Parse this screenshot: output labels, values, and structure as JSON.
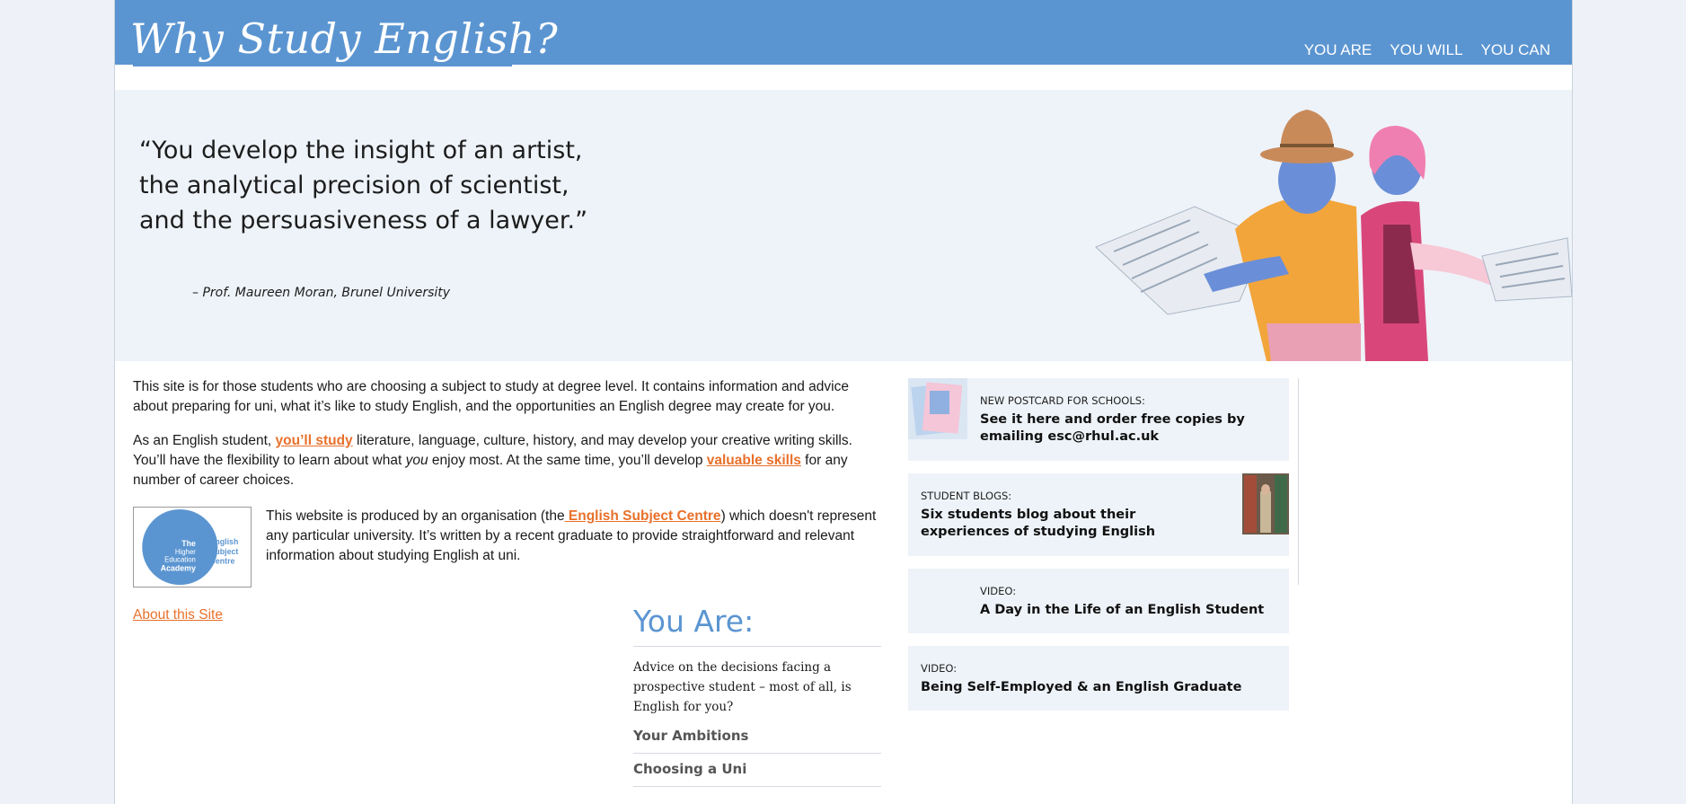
{
  "header": {
    "logo_text": "Why Study English?",
    "nav": [
      "YOU ARE",
      "YOU WILL",
      "YOU CAN"
    ]
  },
  "hero": {
    "quote": "“You develop the insight of an artist, the analytical precision of scientist, and the persuasiveness of a lawyer.”",
    "attribution": "– Prof. Maureen Moran, Brunel University"
  },
  "intro": {
    "p1": "This site is for those students who are choosing a subject to study at degree level. It contains information and advice about preparing for uni, what it’s like to study English, and the opportunities an English degree may create for you.",
    "p2_a": "As an English student, ",
    "p2_link1": "you’ll study",
    "p2_b": " literature, language, culture, history, and may develop your creative writing skills. You’ll have the flexibility to learn about what ",
    "p2_em": "you",
    "p2_c": " enjoy most. At the same time, you’ll develop ",
    "p2_link2": "valuable skills",
    "p2_d": " for any number of career choices."
  },
  "org": {
    "logo_line1": "The Higher Education Academy",
    "logo_line2": "English Subject Centre",
    "text_a": "This website is produced by an organisation (the",
    "link": " English Subject Centre",
    "text_b": ") which doesn't represent any particular university. It’s written by a recent graduate to provide straightforward and relevant information about studying English at uni."
  },
  "about_link": "About this Site",
  "you_are": {
    "title": "You Are:",
    "description": "Advice on the decisions facing a prospective student – most of all, is English for you?",
    "links": [
      "Your Ambitions",
      "Choosing a Uni"
    ]
  },
  "sidebar": {
    "cards": [
      {
        "kicker": "NEW POSTCARD FOR SCHOOLS:",
        "title": "See it here and order free copies by emailing esc@rhul.ac.uk"
      },
      {
        "kicker": "STUDENT BLOGS:",
        "title": "Six students blog about their experiences of studying English"
      },
      {
        "kicker": "VIDEO:",
        "title": "A Day in the Life of an English Student"
      },
      {
        "kicker": "VIDEO:",
        "title": "Being Self-Employed & an English Graduate"
      }
    ]
  },
  "colors": {
    "header_blue": "#5b95d1",
    "link_orange": "#e8702a",
    "panel_bg": "#eef3f9"
  }
}
